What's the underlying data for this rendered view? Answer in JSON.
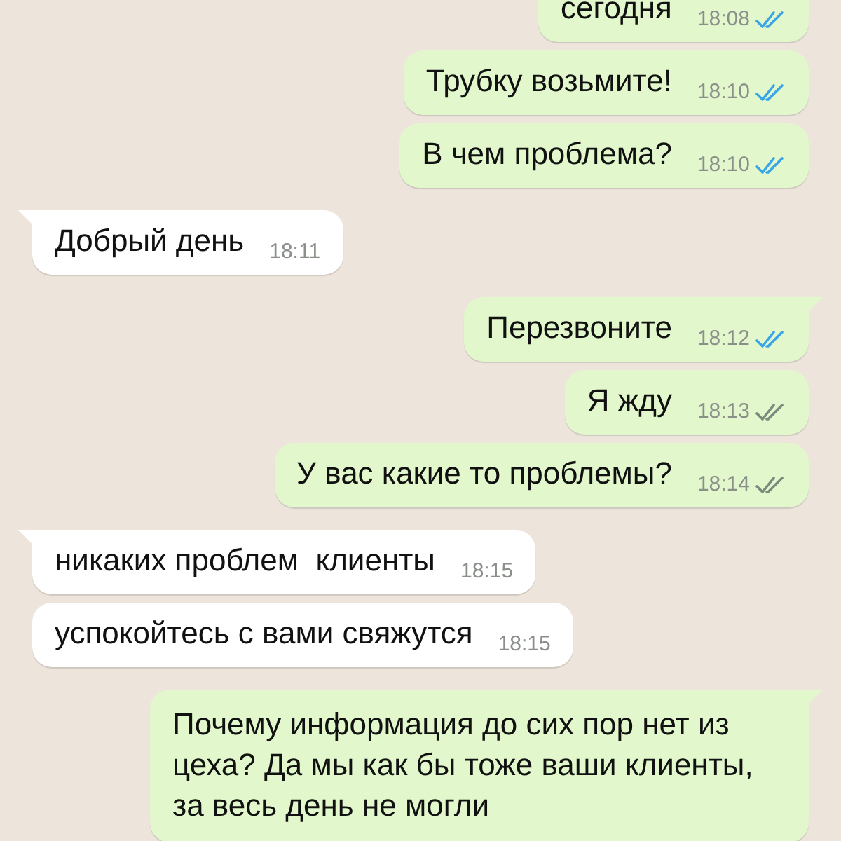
{
  "messages": [
    {
      "outgoing": true,
      "tail": false,
      "text": "сегодня",
      "time": "18:08",
      "read": true
    },
    {
      "outgoing": true,
      "tail": false,
      "text": "Трубку возьмите!",
      "time": "18:10",
      "read": true
    },
    {
      "outgoing": true,
      "tail": false,
      "text": "В чем проблема?",
      "time": "18:10",
      "read": true
    },
    {
      "outgoing": false,
      "tail": true,
      "text": "Добрый день",
      "time": "18:11"
    },
    {
      "outgoing": true,
      "tail": true,
      "text": "Перезвоните",
      "time": "18:12",
      "read": true
    },
    {
      "outgoing": true,
      "tail": false,
      "text": "Я жду",
      "time": "18:13",
      "read": false
    },
    {
      "outgoing": true,
      "tail": false,
      "text": "У вас какие то проблемы?",
      "time": "18:14",
      "read": false
    },
    {
      "outgoing": false,
      "tail": true,
      "text": "никаких проблем  клиенты",
      "time": "18:15"
    },
    {
      "outgoing": false,
      "tail": false,
      "text": "успокойтесь с вами свяжутся",
      "time": "18:15"
    },
    {
      "outgoing": true,
      "tail": true,
      "text": "Почему информация до сих пор нет из цеха? Да мы как бы тоже ваши клиенты, за весь день не могли"
    }
  ]
}
